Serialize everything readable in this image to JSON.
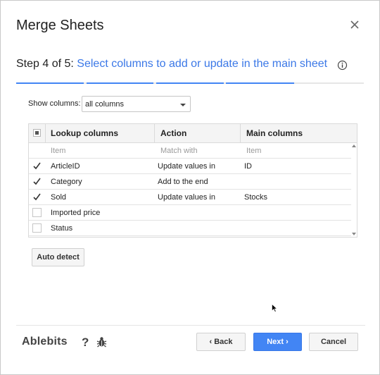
{
  "dialog": {
    "title": "Merge Sheets",
    "step_prefix": "Step 4 of 5:",
    "step_desc": "Select columns to add or update in the main sheet",
    "progress": {
      "current_step": 4,
      "total_steps": 5
    }
  },
  "filter": {
    "label": "Show columns:",
    "selected": "all columns"
  },
  "table": {
    "headers": [
      "Lookup columns",
      "Action",
      "Main columns"
    ],
    "placeholders": {
      "lookup": "Item",
      "action": "Match with",
      "main": "Item"
    },
    "rows": [
      {
        "checked": true,
        "lookup": "ArticleID",
        "action": "Update values in",
        "main": "ID"
      },
      {
        "checked": true,
        "lookup": "Category",
        "action": "Add to the end",
        "main": ""
      },
      {
        "checked": true,
        "lookup": "Sold",
        "action": "Update values in",
        "main": "Stocks"
      },
      {
        "checked": false,
        "lookup": "Imported price",
        "action": "",
        "main": ""
      },
      {
        "checked": false,
        "lookup": "Status",
        "action": "",
        "main": ""
      }
    ]
  },
  "buttons": {
    "auto_detect": "Auto detect",
    "back": "Back",
    "next": "Next",
    "cancel": "Cancel"
  },
  "footer": {
    "brand": "Ablebits",
    "help": "?"
  },
  "colors": {
    "accent": "#4285f4",
    "step_text": "#3b78e7"
  }
}
